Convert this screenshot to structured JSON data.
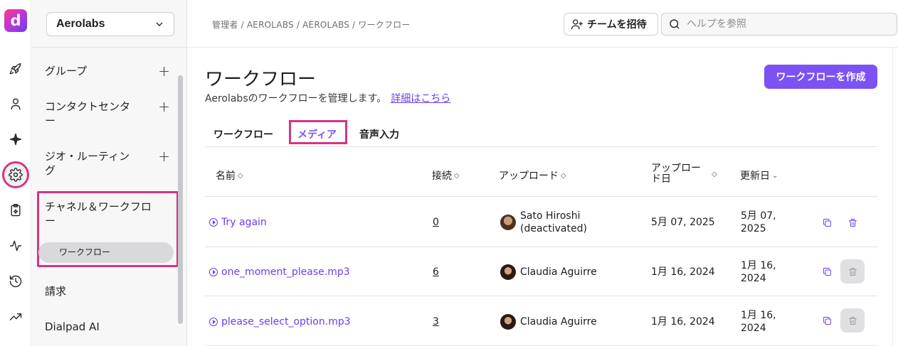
{
  "rail": {
    "logo_letter": "d",
    "icons": [
      "rocket-icon",
      "user-icon",
      "sparkle-icon",
      "gear-icon",
      "clipboard-icon",
      "activity-icon",
      "history-icon",
      "trending-icon"
    ]
  },
  "sidebar": {
    "org": "Aerolabs",
    "items": [
      {
        "label": "グループ",
        "plus": "+"
      },
      {
        "label": "コンタクトセンター",
        "plus": "+"
      },
      {
        "label": "ジオ・ルーティング",
        "plus": "+"
      },
      {
        "label": "チャネル＆ワークフロー"
      },
      {
        "label": "請求"
      },
      {
        "label": "Dialpad AI"
      }
    ],
    "sub_item": "ワークフロー"
  },
  "topbar": {
    "breadcrumb": "管理者 / AEROLABS / AEROLABS / ワークフロー",
    "invite_label": "チームを招待",
    "help_placeholder": "ヘルプを参照"
  },
  "main": {
    "title": "ワークフロー",
    "description": "Aerolabsのワークフローを管理します。",
    "learn_more": "詳細はこちら",
    "create_button": "ワークフローを作成",
    "tabs": [
      "ワークフロー",
      "メディア",
      "音声入力"
    ],
    "active_tab": "メディア"
  },
  "table": {
    "headers": {
      "name": "名前",
      "connections": "接続",
      "uploader": "アップロード",
      "uploaded_line1": "アップロー",
      "uploaded_line2": "ド日",
      "updated": "更新日"
    },
    "rows": [
      {
        "name": "Try again",
        "connections": "0",
        "uploader_line1": "Sato Hiroshi",
        "uploader_line2": "(deactivated)",
        "uploaded": "5月 07, 2025",
        "updated_line1": "5月 07,",
        "updated_line2": "2025",
        "delete_disabled": false
      },
      {
        "name": "one_moment_please.mp3",
        "connections": "6",
        "uploader_line1": "Claudia Aguirre",
        "uploader_line2": "",
        "uploaded": "1月 16, 2024",
        "updated_line1": "1月 16,",
        "updated_line2": "2024",
        "delete_disabled": true
      },
      {
        "name": "please_select_option.mp3",
        "connections": "3",
        "uploader_line1": "Claudia Aguirre",
        "uploader_line2": "",
        "uploaded": "1月 16, 2024",
        "updated_line1": "1月 16,",
        "updated_line2": "2024",
        "delete_disabled": true
      }
    ]
  },
  "colors": {
    "accent": "#7c52f4",
    "highlight": "#d63384",
    "link": "#6e3bf2"
  }
}
